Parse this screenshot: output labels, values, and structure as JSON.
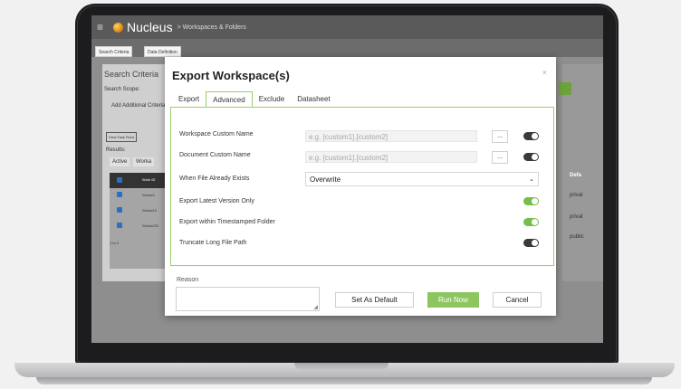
{
  "app": {
    "brand": "Nucleus",
    "breadcrumb": "> Workspaces & Folders"
  },
  "background": {
    "tabs": [
      "Search Criteria",
      "Data Definition"
    ],
    "panel_title": "Search Criteria",
    "search_scope_label": "Search Scope:",
    "add_criteria": "Add Additional Criteria",
    "view_task_runs": "View Task Runs",
    "results_label": "Results:",
    "result_tabs": [
      "Active",
      "Worka"
    ],
    "table_header": "Work ID",
    "rows": [
      "Worka3",
      "Worka15",
      "Worka222"
    ],
    "paging": "1 to 3",
    "right_column_header": "Defa",
    "right_column_values": [
      "privat",
      "privat",
      "public"
    ]
  },
  "modal": {
    "title": "Export Workspace(s)",
    "close_glyph": "×",
    "tabs": [
      {
        "label": "Export",
        "active": false
      },
      {
        "label": "Advanced",
        "active": true
      },
      {
        "label": "Exclude",
        "active": false
      },
      {
        "label": "Datasheet",
        "active": false
      }
    ],
    "fields": {
      "workspace_custom_name": {
        "label": "Workspace Custom Name",
        "placeholder": "e.g. [custom1].[custom2]",
        "button": "...",
        "toggle": false
      },
      "document_custom_name": {
        "label": "Document Custom Name",
        "placeholder": "e.g. [custom1].[custom2]",
        "button": "...",
        "toggle": false
      },
      "when_file_exists": {
        "label": "When File Already Exists",
        "value": "Overwrite"
      },
      "export_latest_version": {
        "label": "Export Latest Version Only",
        "toggle": true
      },
      "export_timestamped": {
        "label": "Export within Timestamped Folder",
        "toggle": true
      },
      "truncate_long_path": {
        "label": "Truncate Long File Path",
        "toggle": false
      }
    },
    "reason_label": "Reason",
    "buttons": {
      "set_default": "Set As Default",
      "run_now": "Run Now",
      "cancel": "Cancel"
    }
  },
  "colors": {
    "accent_green": "#8dc65f",
    "toggle_on": "#76be4a",
    "toggle_off": "#3a3a3a",
    "header_bg": "#5a5a5a"
  }
}
